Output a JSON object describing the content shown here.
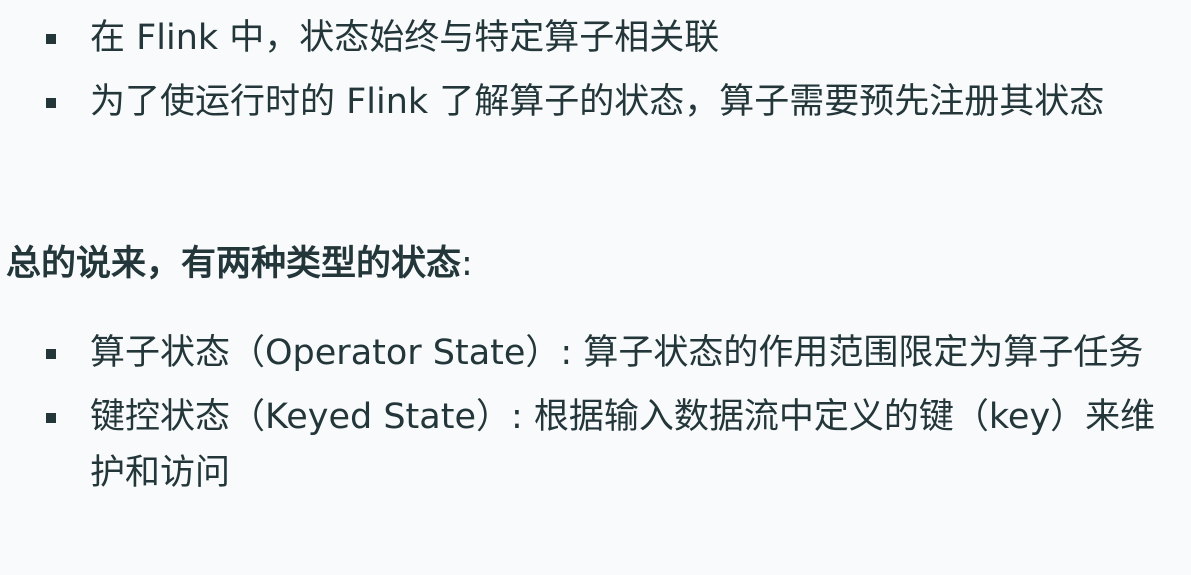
{
  "top_bullets": [
    {
      "text": "在 Flink 中，状态始终与特定算子相关联"
    },
    {
      "text": "为了使运行时的 Flink 了解算子的状态，算子需要预先注册其状态"
    }
  ],
  "summary": {
    "bold_text": "总的说来，有两种类型的状态",
    "suffix": ":"
  },
  "bottom_bullets": [
    {
      "text": "算子状态（Operator State）: 算子状态的作用范围限定为算子任务"
    },
    {
      "text": "键控状态（Keyed State）: 根据输入数据流中定义的键（key）来维护和访问"
    }
  ]
}
